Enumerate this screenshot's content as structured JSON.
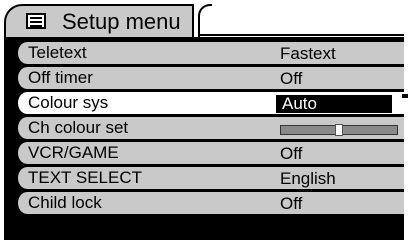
{
  "menu": {
    "title": "Setup menu",
    "title_icon": "list-icon",
    "items": [
      {
        "label": "Teletext",
        "value": "Fastext",
        "selected": false,
        "kind": "text"
      },
      {
        "label": "Off timer",
        "value": "Off",
        "selected": false,
        "kind": "text"
      },
      {
        "label": "Colour sys",
        "value": "Auto",
        "selected": true,
        "kind": "text"
      },
      {
        "label": "Ch colour set",
        "value": null,
        "selected": false,
        "kind": "slider",
        "level": 0.5
      },
      {
        "label": "VCR/GAME",
        "value": "Off",
        "selected": false,
        "kind": "text"
      },
      {
        "label": "TEXT SELECT",
        "value": "English",
        "selected": false,
        "kind": "text"
      },
      {
        "label": "Child lock",
        "value": "Off",
        "selected": false,
        "kind": "text"
      }
    ]
  },
  "colors": {
    "row_bg": "#c9c9c9",
    "selected_row_bg": "#ffffff",
    "highlight": "#000000",
    "frame": "#000000"
  }
}
